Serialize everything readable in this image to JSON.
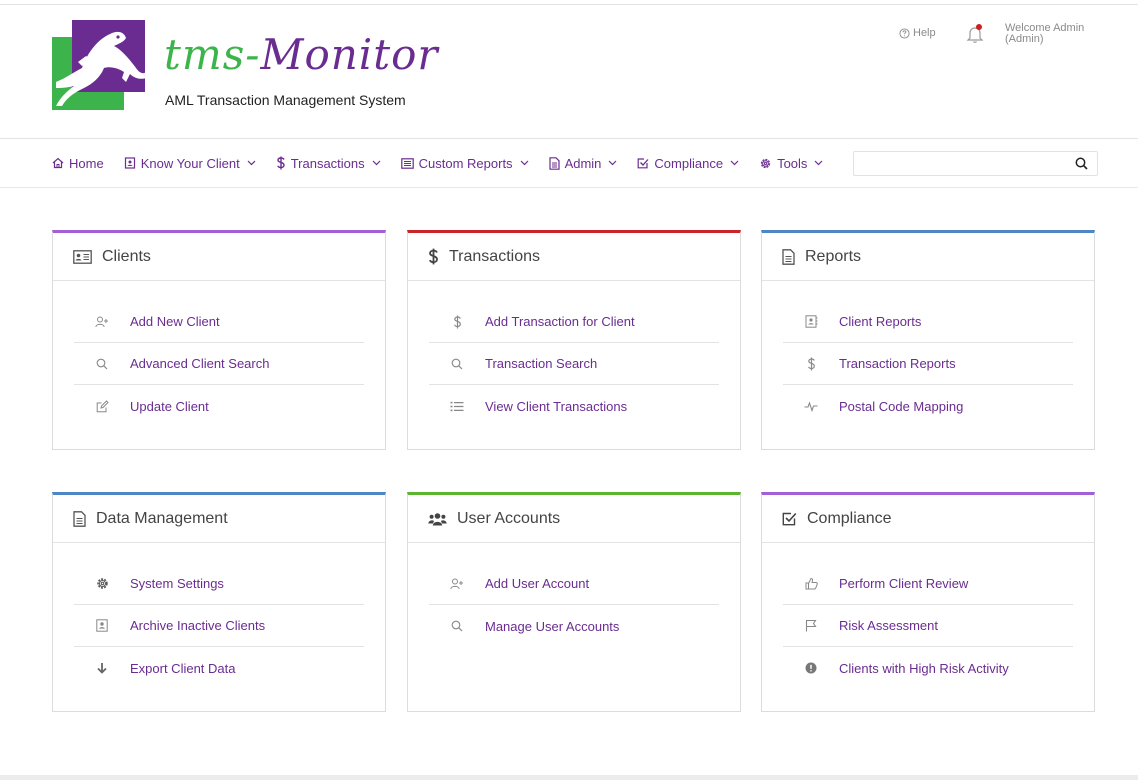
{
  "header": {
    "brand_script_part1": "tms-",
    "brand_script_part2": "Monitor",
    "brand_subtitle": "AML Transaction Management System",
    "help_label": "Help",
    "welcome_line1": "Welcome Admin",
    "welcome_line2": "(Admin)",
    "notification_dot_color": "#cc1f1f"
  },
  "nav": {
    "items": [
      {
        "label": "Home",
        "icon": "home-icon",
        "dropdown": false
      },
      {
        "label": "Know Your Client",
        "icon": "id-card-icon",
        "dropdown": true
      },
      {
        "label": "Transactions",
        "icon": "dollar-icon",
        "dropdown": true
      },
      {
        "label": "Custom Reports",
        "icon": "list-box-icon",
        "dropdown": true
      },
      {
        "label": "Admin",
        "icon": "document-icon",
        "dropdown": true
      },
      {
        "label": "Compliance",
        "icon": "checkbox-icon",
        "dropdown": true
      },
      {
        "label": "Tools",
        "icon": "gear-icon",
        "dropdown": true
      }
    ],
    "search_value": "",
    "search_placeholder": ""
  },
  "colors": {
    "brand_purple": "#6a2c91",
    "brand_green": "#3cb44b",
    "clients_accent": "#a35fd6",
    "transactions_accent": "#c9252b",
    "reports_accent": "#4f86c6",
    "data_management_accent": "#4f86c6",
    "user_accounts_accent": "#5bb52f",
    "compliance_accent": "#a35fd6"
  },
  "cards": {
    "clients": {
      "title": "Clients",
      "items": [
        "Add New Client",
        "Advanced Client Search",
        "Update Client"
      ]
    },
    "transactions": {
      "title": "Transactions",
      "items": [
        "Add Transaction for Client",
        "Transaction Search",
        "View Client Transactions"
      ]
    },
    "reports": {
      "title": "Reports",
      "items": [
        "Client Reports",
        "Transaction Reports",
        "Postal Code Mapping"
      ]
    },
    "data_management": {
      "title": "Data Management",
      "items": [
        "System Settings",
        "Archive Inactive Clients",
        "Export Client Data"
      ]
    },
    "user_accounts": {
      "title": "User Accounts",
      "items": [
        "Add User Account",
        "Manage User Accounts"
      ]
    },
    "compliance": {
      "title": "Compliance",
      "items": [
        "Perform Client Review",
        "Risk Assessment",
        "Clients with High Risk Activity"
      ]
    }
  }
}
